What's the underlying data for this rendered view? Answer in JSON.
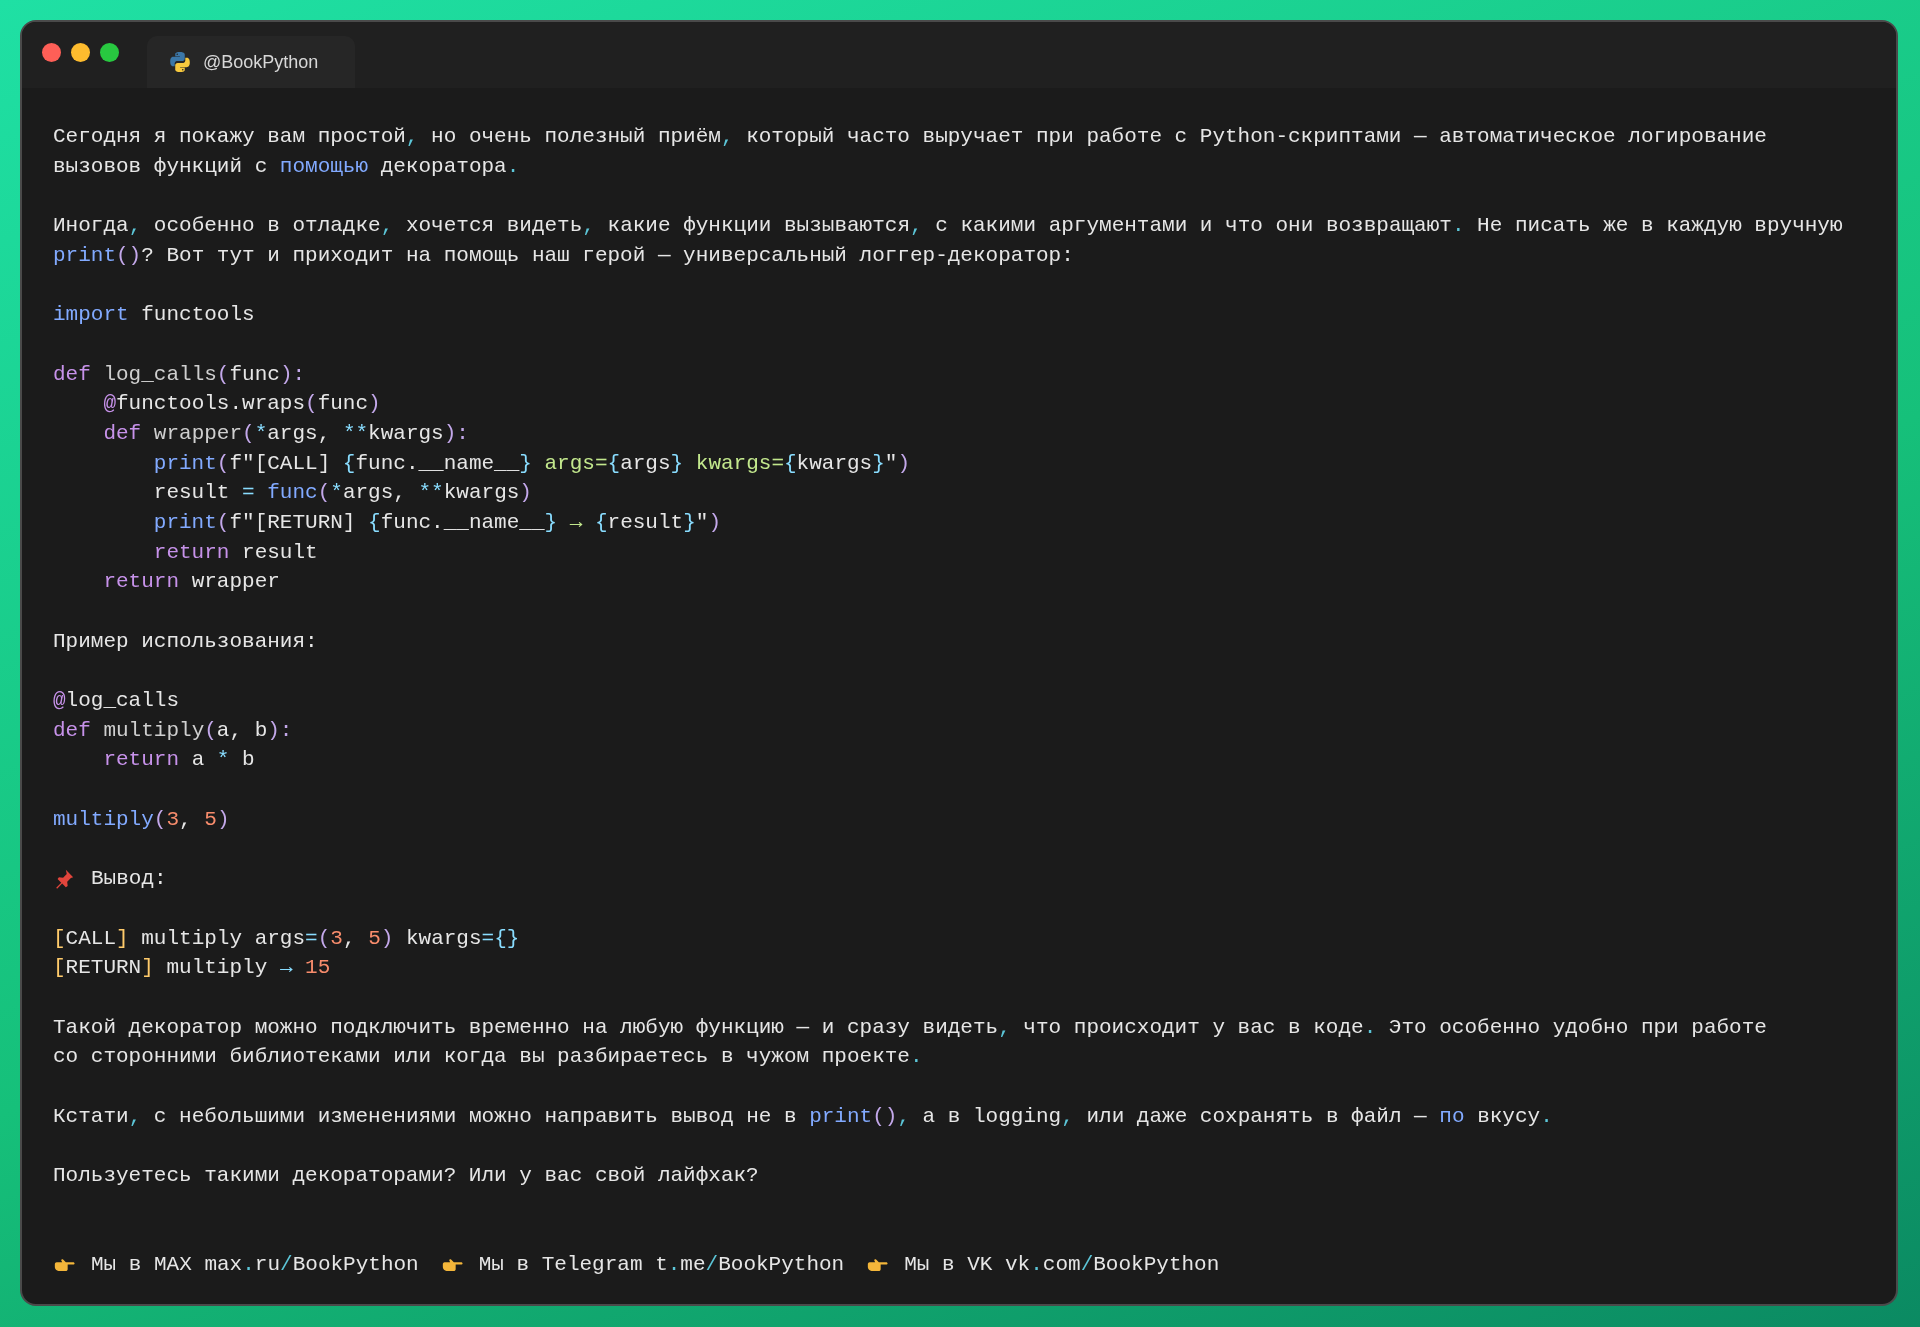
{
  "window": {
    "tab_title": "@BookPython"
  },
  "lines": [
    {
      "kind": "prose",
      "tokens": [
        {
          "kind": "text",
          "text": "Сегодня я покажу вам простой"
        },
        {
          "kind": "punct",
          "text": ","
        },
        {
          "kind": "text",
          "text": " но очень полезный приём"
        },
        {
          "kind": "punct",
          "text": ","
        },
        {
          "kind": "text",
          "text": " который часто выручает при работе с Python-скриптами — автоматическое логирование"
        }
      ]
    },
    {
      "kind": "prose",
      "tokens": [
        {
          "kind": "text",
          "text": "вызовов функций с "
        },
        {
          "kind": "call",
          "text": "помощью"
        },
        {
          "kind": "text",
          "text": " декоратора"
        },
        {
          "kind": "punct",
          "text": "."
        }
      ]
    },
    {
      "kind": "blank"
    },
    {
      "kind": "prose",
      "tokens": [
        {
          "kind": "text",
          "text": "Иногда"
        },
        {
          "kind": "punct",
          "text": ","
        },
        {
          "kind": "text",
          "text": " особенно в отладке"
        },
        {
          "kind": "punct",
          "text": ","
        },
        {
          "kind": "text",
          "text": " хочется видеть"
        },
        {
          "kind": "punct",
          "text": ","
        },
        {
          "kind": "text",
          "text": " какие функции вызываются"
        },
        {
          "kind": "punct",
          "text": ","
        },
        {
          "kind": "text",
          "text": " с какими аргументами и что они возвращают"
        },
        {
          "kind": "punct",
          "text": "."
        },
        {
          "kind": "text",
          "text": " Не писать же в каждую вручную"
        }
      ]
    },
    {
      "kind": "prose",
      "tokens": [
        {
          "kind": "call",
          "text": "print"
        },
        {
          "kind": "paren",
          "text": "()"
        },
        {
          "kind": "text",
          "text": "? Вот тут и приходит на помощь наш герой — универсальный логгер-декоратор:"
        }
      ]
    },
    {
      "kind": "blank"
    },
    {
      "kind": "code",
      "tokens": [
        {
          "kind": "call",
          "text": "import"
        },
        {
          "kind": "text",
          "text": " functools"
        }
      ]
    },
    {
      "kind": "blank"
    },
    {
      "kind": "code",
      "tokens": [
        {
          "kind": "keyword",
          "text": "def"
        },
        {
          "kind": "name",
          "text": " log_calls"
        },
        {
          "kind": "paren",
          "text": "("
        },
        {
          "kind": "text",
          "text": "func"
        },
        {
          "kind": "paren",
          "text": "):"
        }
      ]
    },
    {
      "kind": "code",
      "tokens": [
        {
          "kind": "keyword",
          "text": "    @"
        },
        {
          "kind": "text",
          "text": "functools.wraps"
        },
        {
          "kind": "paren",
          "text": "("
        },
        {
          "kind": "text",
          "text": "func"
        },
        {
          "kind": "paren",
          "text": ")"
        }
      ]
    },
    {
      "kind": "code",
      "tokens": [
        {
          "kind": "keyword",
          "text": "    def"
        },
        {
          "kind": "name",
          "text": " wrapper"
        },
        {
          "kind": "paren",
          "text": "("
        },
        {
          "kind": "operator",
          "text": "*"
        },
        {
          "kind": "text",
          "text": "args, "
        },
        {
          "kind": "operator",
          "text": "**"
        },
        {
          "kind": "text",
          "text": "kwargs"
        },
        {
          "kind": "paren",
          "text": "):"
        }
      ]
    },
    {
      "kind": "code",
      "tokens": [
        {
          "kind": "call",
          "text": "        print"
        },
        {
          "kind": "paren",
          "text": "("
        },
        {
          "kind": "text",
          "text": "f\"[CALL] "
        },
        {
          "kind": "brace",
          "text": "{"
        },
        {
          "kind": "text",
          "text": "func.__name__"
        },
        {
          "kind": "brace",
          "text": "}"
        },
        {
          "kind": "string",
          "text": " args="
        },
        {
          "kind": "brace",
          "text": "{"
        },
        {
          "kind": "text",
          "text": "args"
        },
        {
          "kind": "brace",
          "text": "}"
        },
        {
          "kind": "string",
          "text": " kwargs="
        },
        {
          "kind": "brace",
          "text": "{"
        },
        {
          "kind": "text",
          "text": "kwargs"
        },
        {
          "kind": "brace",
          "text": "}"
        },
        {
          "kind": "text",
          "text": "\""
        },
        {
          "kind": "paren",
          "text": ")"
        }
      ]
    },
    {
      "kind": "code",
      "tokens": [
        {
          "kind": "text",
          "text": "        result "
        },
        {
          "kind": "operator",
          "text": "="
        },
        {
          "kind": "call",
          "text": " func"
        },
        {
          "kind": "paren",
          "text": "("
        },
        {
          "kind": "operator",
          "text": "*"
        },
        {
          "kind": "text",
          "text": "args, "
        },
        {
          "kind": "operator",
          "text": "**"
        },
        {
          "kind": "text",
          "text": "kwargs"
        },
        {
          "kind": "paren",
          "text": ")"
        }
      ]
    },
    {
      "kind": "code",
      "tokens": [
        {
          "kind": "call",
          "text": "        print"
        },
        {
          "kind": "paren",
          "text": "("
        },
        {
          "kind": "text",
          "text": "f\"[RETURN] "
        },
        {
          "kind": "brace",
          "text": "{"
        },
        {
          "kind": "text",
          "text": "func.__name__"
        },
        {
          "kind": "brace",
          "text": "}"
        },
        {
          "kind": "string",
          "text": " → "
        },
        {
          "kind": "brace",
          "text": "{"
        },
        {
          "kind": "text",
          "text": "result"
        },
        {
          "kind": "brace",
          "text": "}"
        },
        {
          "kind": "text",
          "text": "\""
        },
        {
          "kind": "paren",
          "text": ")"
        }
      ]
    },
    {
      "kind": "code",
      "tokens": [
        {
          "kind": "keyword",
          "text": "        return"
        },
        {
          "kind": "text",
          "text": " result"
        }
      ]
    },
    {
      "kind": "code",
      "tokens": [
        {
          "kind": "keyword",
          "text": "    return"
        },
        {
          "kind": "text",
          "text": " wrapper"
        }
      ]
    },
    {
      "kind": "blank"
    },
    {
      "kind": "prose",
      "tokens": [
        {
          "kind": "text",
          "text": "Пример использования:"
        }
      ]
    },
    {
      "kind": "blank"
    },
    {
      "kind": "code",
      "tokens": [
        {
          "kind": "keyword",
          "text": "@"
        },
        {
          "kind": "text",
          "text": "log_calls"
        }
      ]
    },
    {
      "kind": "code",
      "tokens": [
        {
          "kind": "keyword",
          "text": "def"
        },
        {
          "kind": "name",
          "text": " multiply"
        },
        {
          "kind": "paren",
          "text": "("
        },
        {
          "kind": "text",
          "text": "a, b"
        },
        {
          "kind": "paren",
          "text": "):"
        }
      ]
    },
    {
      "kind": "code",
      "tokens": [
        {
          "kind": "keyword",
          "text": "    return"
        },
        {
          "kind": "text",
          "text": " a "
        },
        {
          "kind": "operator",
          "text": "*"
        },
        {
          "kind": "text",
          "text": " b"
        }
      ]
    },
    {
      "kind": "blank"
    },
    {
      "kind": "code",
      "tokens": [
        {
          "kind": "call",
          "text": "multiply"
        },
        {
          "kind": "paren",
          "text": "("
        },
        {
          "kind": "number",
          "text": "3"
        },
        {
          "kind": "text",
          "text": ", "
        },
        {
          "kind": "number",
          "text": "5"
        },
        {
          "kind": "paren",
          "text": ")"
        }
      ]
    },
    {
      "kind": "blank"
    },
    {
      "kind": "pinned",
      "tokens": [
        {
          "kind": "text",
          "text": "Вывод:"
        }
      ]
    },
    {
      "kind": "blank"
    },
    {
      "kind": "code",
      "tokens": [
        {
          "kind": "bracket",
          "text": "["
        },
        {
          "kind": "text",
          "text": "CALL"
        },
        {
          "kind": "bracket",
          "text": "]"
        },
        {
          "kind": "text",
          "text": " multiply args"
        },
        {
          "kind": "operator",
          "text": "="
        },
        {
          "kind": "paren",
          "text": "("
        },
        {
          "kind": "number",
          "text": "3"
        },
        {
          "kind": "text",
          "text": ", "
        },
        {
          "kind": "number",
          "text": "5"
        },
        {
          "kind": "paren",
          "text": ")"
        },
        {
          "kind": "text",
          "text": " kwargs"
        },
        {
          "kind": "operator",
          "text": "="
        },
        {
          "kind": "brace",
          "text": "{}"
        }
      ]
    },
    {
      "kind": "code",
      "tokens": [
        {
          "kind": "bracket",
          "text": "["
        },
        {
          "kind": "text",
          "text": "RETURN"
        },
        {
          "kind": "bracket",
          "text": "]"
        },
        {
          "kind": "text",
          "text": " multiply "
        },
        {
          "kind": "operator",
          "text": "→"
        },
        {
          "kind": "number",
          "text": " 15"
        }
      ]
    },
    {
      "kind": "blank"
    },
    {
      "kind": "prose",
      "tokens": [
        {
          "kind": "text",
          "text": "Такой декоратор можно подключить временно на любую функцию — и сразу видеть"
        },
        {
          "kind": "punct",
          "text": ","
        },
        {
          "kind": "text",
          "text": " что происходит у вас в коде"
        },
        {
          "kind": "punct",
          "text": "."
        },
        {
          "kind": "text",
          "text": " Это особенно удобно при работе"
        }
      ]
    },
    {
      "kind": "prose",
      "tokens": [
        {
          "kind": "text",
          "text": "со сторонними библиотеками или когда вы разбираетесь в чужом проекте"
        },
        {
          "kind": "punct",
          "text": "."
        }
      ]
    },
    {
      "kind": "blank"
    },
    {
      "kind": "prose",
      "tokens": [
        {
          "kind": "text",
          "text": "Кстати"
        },
        {
          "kind": "punct",
          "text": ","
        },
        {
          "kind": "text",
          "text": " с небольшими изменениями можно направить вывод не в "
        },
        {
          "kind": "call",
          "text": "print"
        },
        {
          "kind": "paren",
          "text": "()"
        },
        {
          "kind": "punct",
          "text": ","
        },
        {
          "kind": "text",
          "text": " а в logging"
        },
        {
          "kind": "punct",
          "text": ","
        },
        {
          "kind": "text",
          "text": " или даже сохранять в файл — "
        },
        {
          "kind": "call",
          "text": "по"
        },
        {
          "kind": "text",
          "text": " вкусу"
        },
        {
          "kind": "punct",
          "text": "."
        }
      ]
    },
    {
      "kind": "blank"
    },
    {
      "kind": "prose",
      "tokens": [
        {
          "kind": "text",
          "text": "Пользуетесь такими декораторами? Или у вас свой лайфхак?"
        }
      ]
    },
    {
      "kind": "blank"
    },
    {
      "kind": "blank"
    }
  ],
  "footer": [
    {
      "tokens": [
        {
          "kind": "text",
          "text": "Мы в MAX max"
        },
        {
          "kind": "punct",
          "text": "."
        },
        {
          "kind": "text",
          "text": "ru"
        },
        {
          "kind": "punct",
          "text": "/"
        },
        {
          "kind": "text",
          "text": "BookPython"
        }
      ]
    },
    {
      "tokens": [
        {
          "kind": "text",
          "text": "Мы в Telegram t"
        },
        {
          "kind": "punct",
          "text": "."
        },
        {
          "kind": "text",
          "text": "me"
        },
        {
          "kind": "punct",
          "text": "/"
        },
        {
          "kind": "text",
          "text": "BookPython"
        }
      ]
    },
    {
      "tokens": [
        {
          "kind": "text",
          "text": "Мы в VK vk"
        },
        {
          "kind": "punct",
          "text": "."
        },
        {
          "kind": "text",
          "text": "com"
        },
        {
          "kind": "punct",
          "text": "/"
        },
        {
          "kind": "text",
          "text": "BookPython"
        }
      ]
    }
  ]
}
